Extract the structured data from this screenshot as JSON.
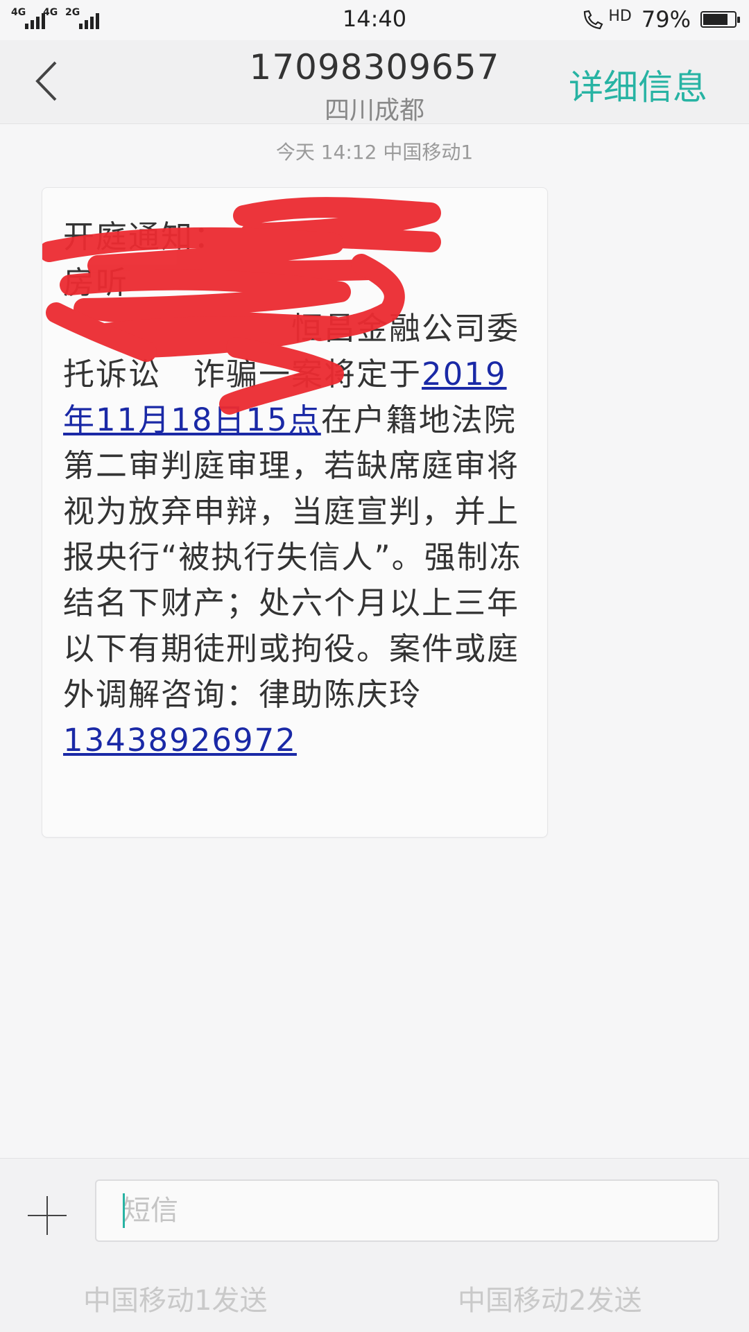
{
  "status_bar": {
    "signal1": "4G",
    "signal1b": "4G",
    "signal2": "2G",
    "time": "14:40",
    "call_hd": "HD",
    "battery_percent_text": "79%",
    "battery_level": 0.79
  },
  "header": {
    "title": "17098309657",
    "subtitle": "四川成都",
    "details_label": "详细信息"
  },
  "thread": {
    "timestamp": "今天  14:12  中国移动1",
    "message": {
      "part1": "开庭通知：",
      "part2": "房听",
      "part3": "恒昌金融公司委托诉讼",
      "part4": "诈骗一案将定于",
      "date_link": "2019年11月18日15点",
      "part5": "在户籍地法院第二审判庭审理，若缺席庭审将视为放弃申辩，当庭宣判，并上报央行“被执行失信人”。强制冻结名下财产；处六个月以上三年以下有期徒刑或拘役。案件或庭外调解咨询：律助陈庆玲",
      "phone_link": "13438926972"
    }
  },
  "compose": {
    "placeholder": "短信",
    "send1_label": "中国移动1发送",
    "send2_label": "中国移动2发送"
  }
}
